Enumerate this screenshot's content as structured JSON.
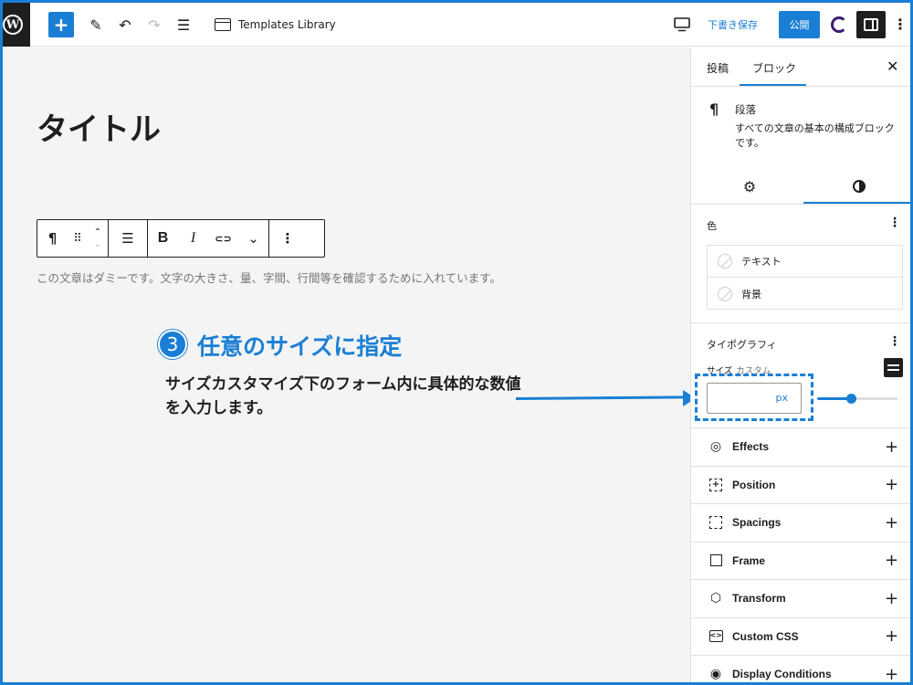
{
  "topbar": {
    "logo": "W",
    "add_icon": "+",
    "pen_icon": "✎",
    "undo_icon": "↶",
    "redo_icon": "↷",
    "list_icon": "☰",
    "doc_title": "Templates Library",
    "save_draft": "下書き保存",
    "publish": "公開",
    "more_icon": "⋮"
  },
  "canvas": {
    "post_title": "タイトル",
    "toolbar": {
      "pilcrow": "¶",
      "drag": "⠿",
      "up": "⌃",
      "down": "⌄",
      "align": "☰",
      "bold": "B",
      "italic": "I",
      "link": "⊂⊃",
      "more_chevron": "⌄",
      "options": "⋮"
    },
    "paragraph": "この文章はダミーです。文字の大きさ、量、字間、行間等を確認するために入れています。"
  },
  "annotation": {
    "step_number": "3",
    "title": "任意のサイズに指定",
    "description": "サイズカスタマイズ下のフォーム内に具体的な数値を入力します。"
  },
  "sidebar": {
    "tabs": {
      "post": "投稿",
      "block": "ブロック",
      "close": "✕"
    },
    "block_card": {
      "icon": "¶",
      "name": "段落",
      "description": "すべての文章の基本の構成ブロックです。"
    },
    "sub_tabs": {
      "settings_icon": "⚙"
    },
    "color": {
      "label": "色",
      "more": "⋮",
      "text": "テキスト",
      "background": "背景"
    },
    "typography": {
      "label": "タイポグラフィ",
      "more": "⋮",
      "size_label": "サイズ",
      "custom_label": "カスタム",
      "size_value": "",
      "unit": "px",
      "slider_fraction": 0.42
    },
    "tools": [
      {
        "label": "Effects",
        "icon": "◎",
        "plus": "+"
      },
      {
        "label": "Position",
        "icon": "+",
        "plus": "+"
      },
      {
        "label": "Spacings",
        "icon": "",
        "plus": "+"
      },
      {
        "label": "Frame",
        "icon": "",
        "plus": "+"
      },
      {
        "label": "Transform",
        "icon": "⬡",
        "plus": "+"
      },
      {
        "label": "Custom CSS",
        "icon": "<>",
        "plus": "+"
      },
      {
        "label": "Display Conditions",
        "icon": "◉",
        "plus": "+"
      }
    ]
  },
  "colors": {
    "accent": "#1a7fd4",
    "dark": "#1e1e1e",
    "canvas_bg": "#f4f4f4"
  }
}
